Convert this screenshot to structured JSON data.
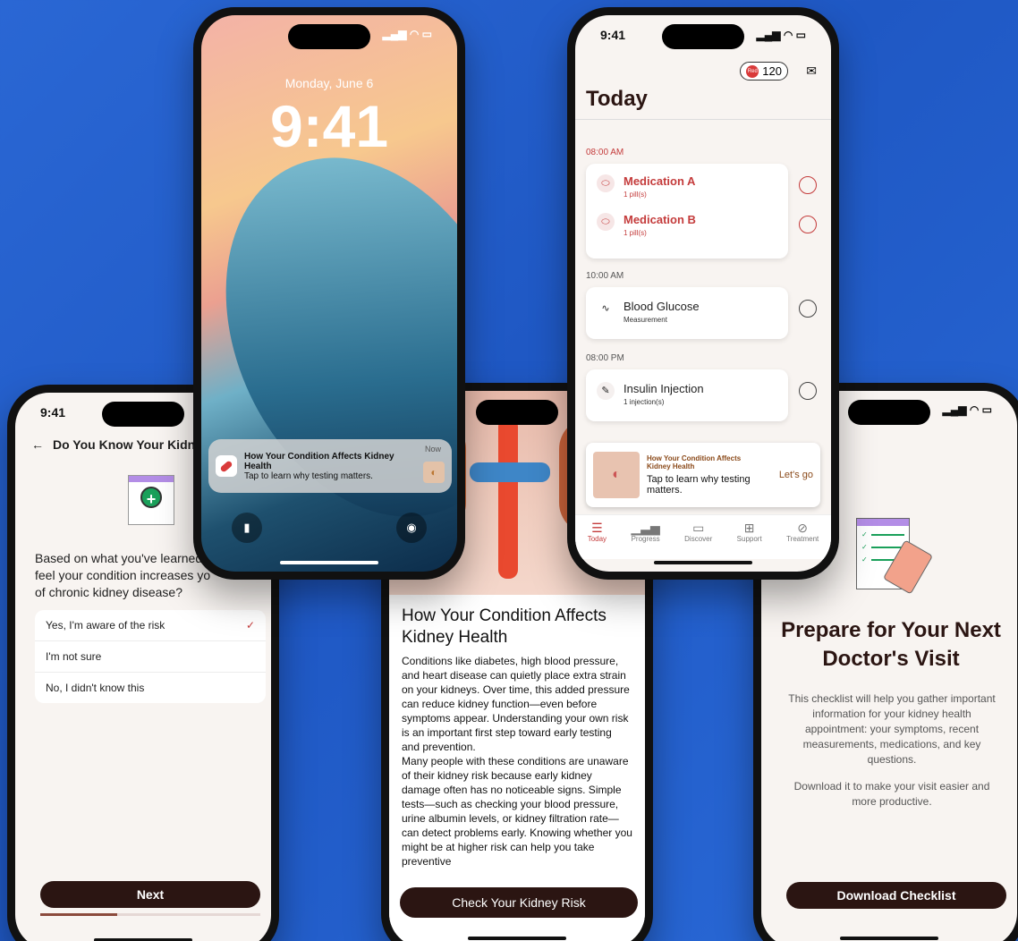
{
  "quiz": {
    "time": "9:41",
    "title": "Do You Know Your Kidne",
    "question": "Based on what you've learned,\nfeel your condition increases yo\nof chronic kidney disease?",
    "options": [
      "Yes, I'm aware of the risk",
      "I'm not sure",
      "No, I didn't know this"
    ],
    "selected_index": 0,
    "next_label": "Next",
    "progress": 0.35
  },
  "lock": {
    "date": "Monday, June 6",
    "time": "9:41",
    "notification": {
      "title": "How Your Condition Affects Kidney Health",
      "body": "Tap to learn why testing matters.",
      "time": "Now"
    }
  },
  "article": {
    "title": "How Your Condition Affects Kidney Health",
    "para1": "Conditions like diabetes, high blood pressure, and heart disease can quietly place extra strain on your kidneys. Over time, this added pressure can reduce kidney function—even before symptoms appear. Understanding your own risk is an important first step toward early testing and prevention.",
    "para2": "Many people with these conditions are unaware of their kidney risk because early kidney damage often has no noticeable signs. Simple tests—such as checking your blood pressure, urine albumin levels, or kidney filtration rate—can detect problems early. Knowing whether you might be at higher risk can help you take preventive",
    "cta": "Check Your Kidney Risk"
  },
  "today": {
    "time": "9:41",
    "points": "120",
    "points_badge": "Red",
    "title": "Today",
    "slots": [
      {
        "time": "08:00 AM",
        "items": [
          {
            "name": "Medication A",
            "sub": "1 pill(s)"
          },
          {
            "name": "Medication B",
            "sub": "1 pill(s)"
          }
        ]
      },
      {
        "time": "10:00 AM",
        "items": [
          {
            "name": "Blood Glucose",
            "sub": "Measurement"
          }
        ]
      },
      {
        "time": "08:00 PM",
        "items": [
          {
            "name": "Insulin Injection",
            "sub": "1 injection(s)"
          }
        ]
      }
    ],
    "promo": {
      "title": "How Your Condition Affects Kidney Health",
      "body": "Tap to learn why testing matters.",
      "action": "Let's go"
    },
    "tabs": [
      "Today",
      "Progress",
      "Discover",
      "Support",
      "Treatment"
    ]
  },
  "checklist": {
    "title": "Prepare for Your Next Doctor's Visit",
    "body1": "This checklist will help you gather important information for your kidney health appointment: your symptoms, recent measurements, medications, and key questions.",
    "body2": "Download it to make your visit easier and more productive.",
    "cta": "Download Checklist"
  }
}
